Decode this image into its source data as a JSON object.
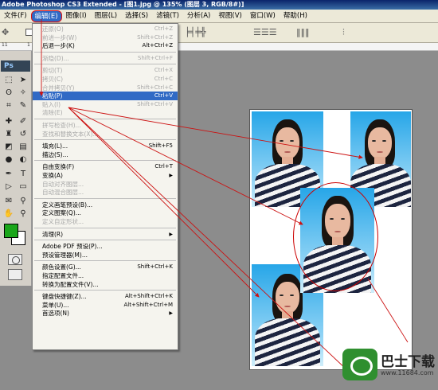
{
  "window": {
    "title": "Adobe Photoshop CS3 Extended - [图1.jpg @ 135% (图层 3, RGB/8#)]"
  },
  "menubar": {
    "items": [
      "文件(F)",
      "编辑(E)",
      "图像(I)",
      "图层(L)",
      "选择(S)",
      "滤镜(T)",
      "分析(A)",
      "视图(V)",
      "窗口(W)",
      "帮助(H)"
    ],
    "active_index": 1
  },
  "toolbox": {
    "logo": "Ps"
  },
  "ruler": {
    "labels": [
      "11",
      "1"
    ]
  },
  "edit_menu": {
    "items": [
      {
        "label": "还原(O)",
        "shortcut": "Ctrl+Z",
        "disabled": true
      },
      {
        "label": "前进一步(W)",
        "shortcut": "Shift+Ctrl+Z",
        "disabled": true
      },
      {
        "label": "后退一步(K)",
        "shortcut": "Alt+Ctrl+Z",
        "disabled": false
      },
      {
        "sep": true
      },
      {
        "label": "渐隐(D)...",
        "shortcut": "Shift+Ctrl+F",
        "disabled": true
      },
      {
        "sep": true
      },
      {
        "label": "剪切(T)",
        "shortcut": "Ctrl+X",
        "disabled": true
      },
      {
        "label": "拷贝(C)",
        "shortcut": "Ctrl+C",
        "disabled": true
      },
      {
        "label": "合并拷贝(Y)",
        "shortcut": "Shift+Ctrl+C",
        "disabled": true
      },
      {
        "label": "粘贴(P)",
        "shortcut": "Ctrl+V",
        "disabled": false,
        "highlight": true
      },
      {
        "label": "贴入(I)",
        "shortcut": "Shift+Ctrl+V",
        "disabled": true
      },
      {
        "label": "清除(E)",
        "shortcut": "",
        "disabled": true
      },
      {
        "sep": true
      },
      {
        "label": "拼写检查(H)...",
        "shortcut": "",
        "disabled": true
      },
      {
        "label": "查找和替换文本(X)...",
        "shortcut": "",
        "disabled": true
      },
      {
        "sep": true
      },
      {
        "label": "填充(L)...",
        "shortcut": "Shift+F5",
        "disabled": false
      },
      {
        "label": "描边(S)...",
        "shortcut": "",
        "disabled": false
      },
      {
        "sep": true
      },
      {
        "label": "自由变换(F)",
        "shortcut": "Ctrl+T",
        "disabled": false
      },
      {
        "label": "变换(A)",
        "shortcut": "",
        "disabled": false,
        "submenu": true
      },
      {
        "label": "自动对齐图层...",
        "shortcut": "",
        "disabled": true
      },
      {
        "label": "自动混合图层...",
        "shortcut": "",
        "disabled": true
      },
      {
        "sep": true
      },
      {
        "label": "定义画笔预设(B)...",
        "shortcut": "",
        "disabled": false
      },
      {
        "label": "定义图案(Q)...",
        "shortcut": "",
        "disabled": false
      },
      {
        "label": "定义自定形状...",
        "shortcut": "",
        "disabled": true
      },
      {
        "sep": true
      },
      {
        "label": "清理(R)",
        "shortcut": "",
        "disabled": false,
        "submenu": true
      },
      {
        "sep": true
      },
      {
        "label": "Adobe PDF 预设(P)...",
        "shortcut": "",
        "disabled": false
      },
      {
        "label": "预设管理器(M)...",
        "shortcut": "",
        "disabled": false
      },
      {
        "sep": true
      },
      {
        "label": "颜色设置(G)...",
        "shortcut": "Shift+Ctrl+K",
        "disabled": false
      },
      {
        "label": "指定配置文件...",
        "shortcut": "",
        "disabled": false
      },
      {
        "label": "转换为配置文件(V)...",
        "shortcut": "",
        "disabled": false
      },
      {
        "sep": true
      },
      {
        "label": "键盘快捷键(Z)...",
        "shortcut": "Alt+Shift+Ctrl+K",
        "disabled": false
      },
      {
        "label": "菜单(U)...",
        "shortcut": "Alt+Shift+Ctrl+M",
        "disabled": false
      },
      {
        "label": "首选项(N)",
        "shortcut": "",
        "disabled": false,
        "submenu": true
      }
    ]
  },
  "watermark": {
    "name": "巴士下载",
    "url": "www.11684.com"
  },
  "colors": {
    "foreground": "#1aa61a",
    "background": "#ffffff",
    "highlight": "#316ac5",
    "arrow": "#cc1111"
  }
}
